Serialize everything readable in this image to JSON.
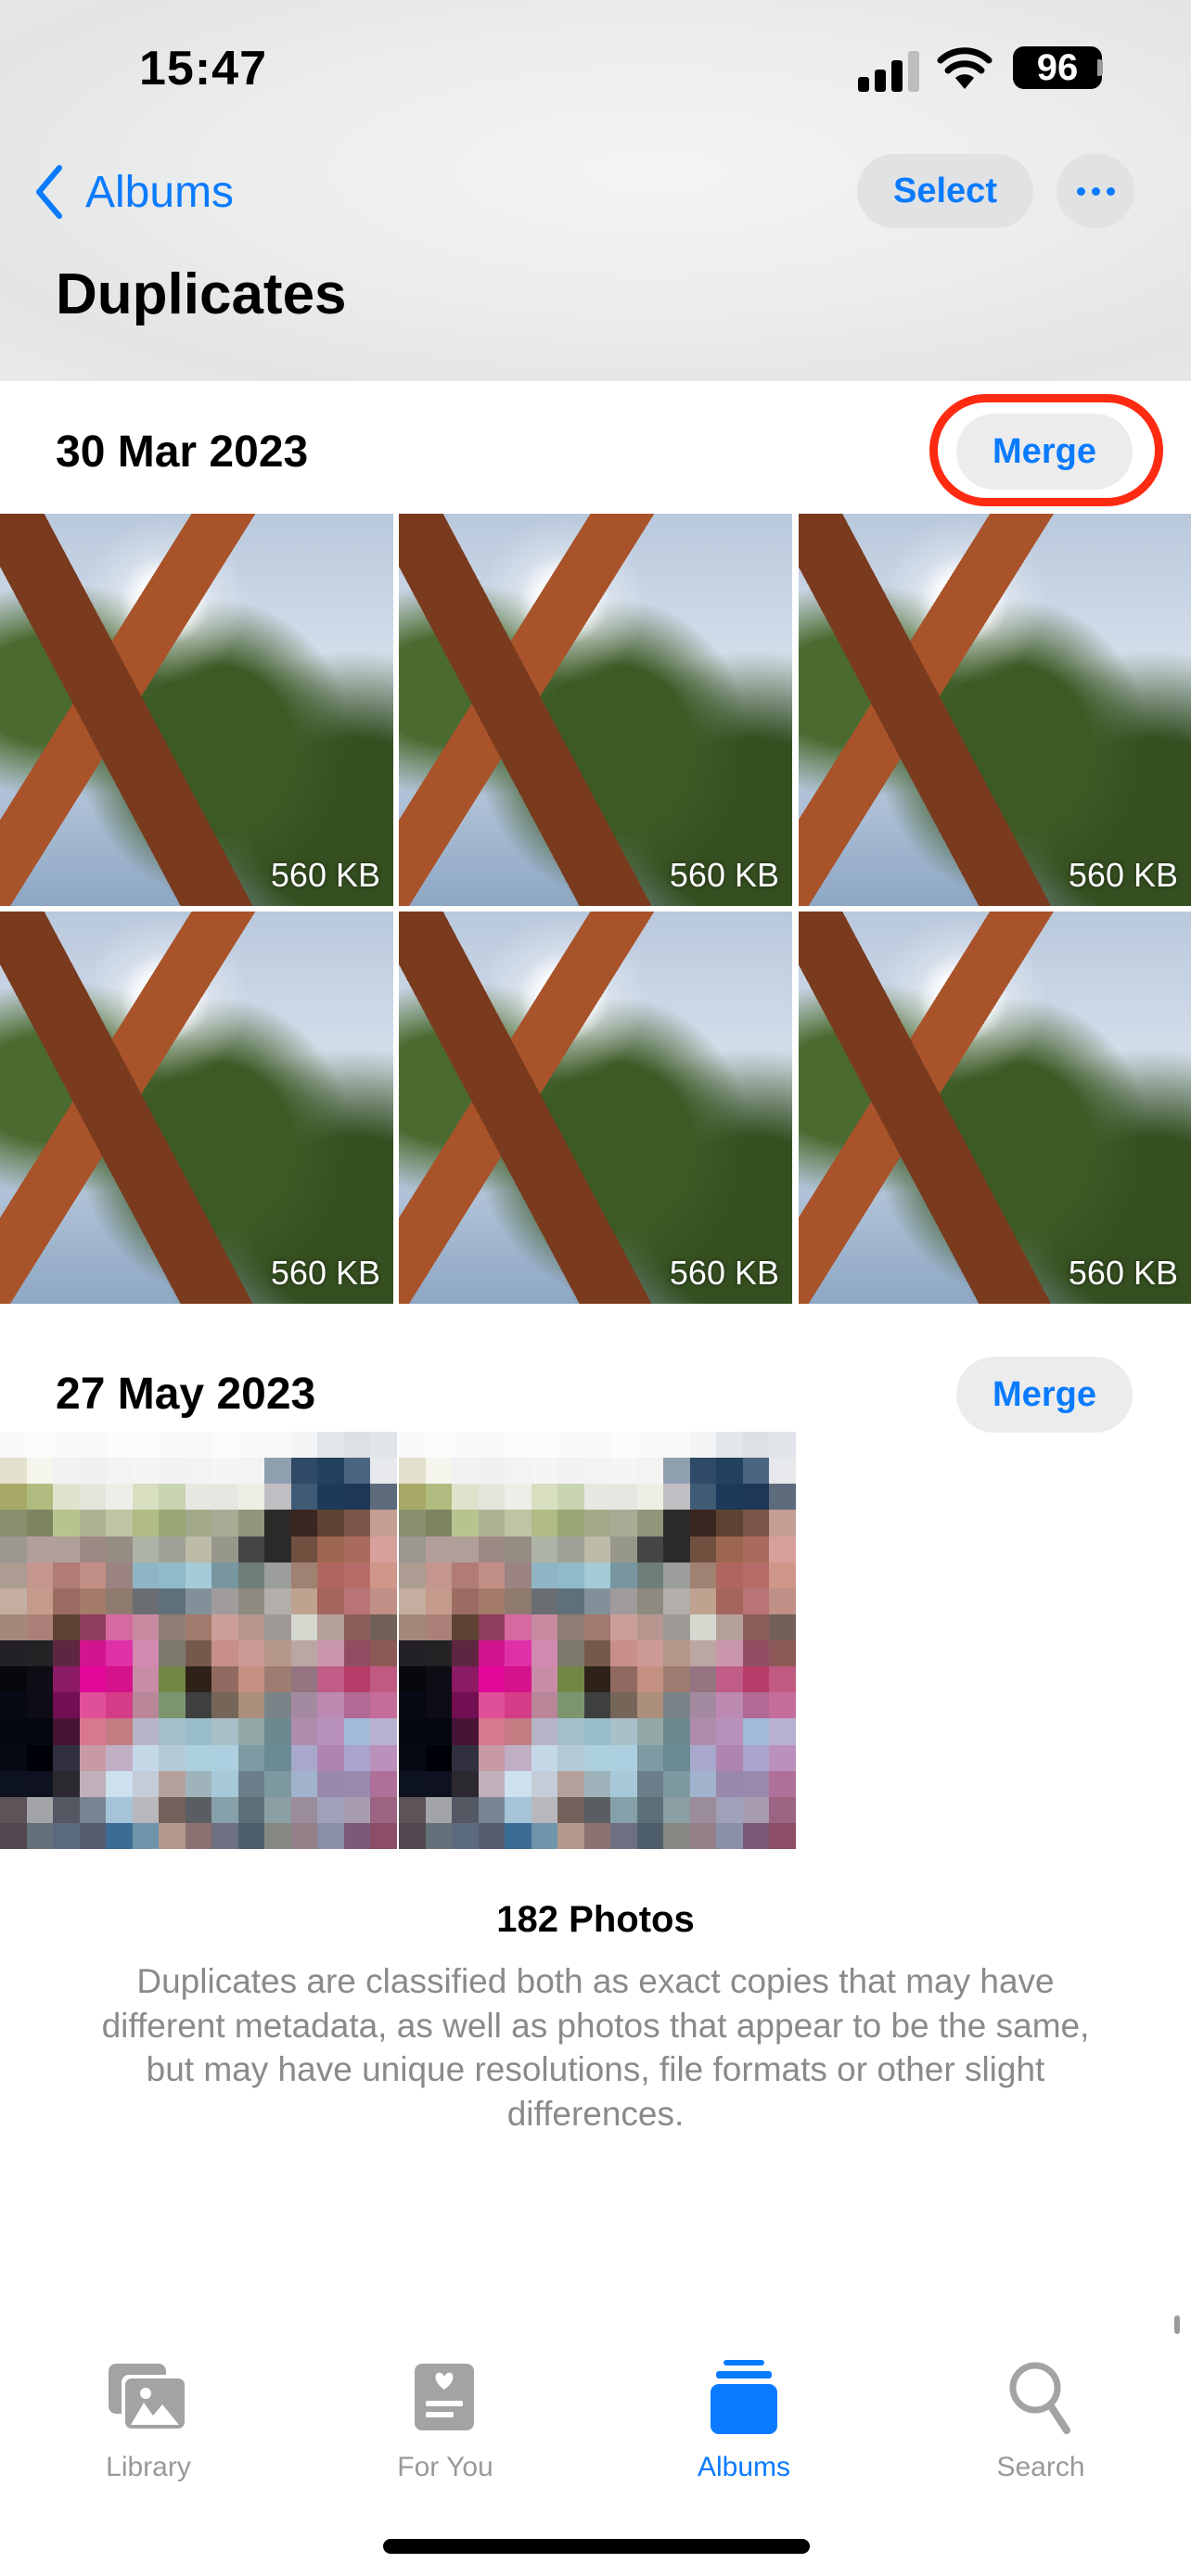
{
  "status_bar": {
    "time": "15:47",
    "battery": "96",
    "signal_bars": 3,
    "signal_max": 4,
    "icons": [
      "cellular-signal-icon",
      "wifi-icon",
      "battery-icon"
    ]
  },
  "nav": {
    "back_label": "Albums",
    "select_label": "Select",
    "more_icon": "ellipsis-icon",
    "title": "Duplicates"
  },
  "sections": [
    {
      "date": "30 Mar 2023",
      "merge_label": "Merge",
      "highlighted": true,
      "highlight_color": "#ff2a12",
      "photos": [
        {
          "size": "560 KB"
        },
        {
          "size": "560 KB"
        },
        {
          "size": "560 KB"
        },
        {
          "size": "560 KB"
        },
        {
          "size": "560 KB"
        },
        {
          "size": "560 KB"
        }
      ]
    },
    {
      "date": "27 May 2023",
      "merge_label": "Merge",
      "highlighted": false,
      "photos_note": "pixelated/obscured thumbnails"
    }
  ],
  "footer": {
    "count": "182 Photos",
    "description": "Duplicates are classified both as exact copies that may have different metadata, as well as photos that appear to be the same, but may have unique resolutions, file formats or other slight differences."
  },
  "tab_bar": {
    "tabs": [
      {
        "label": "Library",
        "icon": "photo-library-icon",
        "active": false
      },
      {
        "label": "For You",
        "icon": "for-you-icon",
        "active": false
      },
      {
        "label": "Albums",
        "icon": "albums-icon",
        "active": true
      },
      {
        "label": "Search",
        "icon": "search-icon",
        "active": false
      }
    ]
  },
  "colors": {
    "accent": "#0a7bff",
    "inactive_tab": "#999999",
    "secondary_text": "#8a8a8e",
    "button_bg": "#ececed"
  }
}
